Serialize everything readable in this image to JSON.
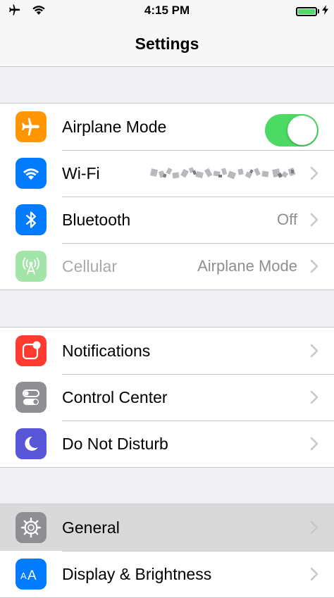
{
  "status_bar": {
    "time": "4:15 PM",
    "icons": [
      "airplane-icon",
      "wifi-icon",
      "battery-icon",
      "charging-bolt-icon"
    ]
  },
  "nav": {
    "title": "Settings"
  },
  "colors": {
    "orange": "#ff9500",
    "blue": "#007aff",
    "green_dim": "#a3e4a8",
    "red": "#ff3b30",
    "gray": "#8e8e93",
    "purple": "#5856d6",
    "toggle_on": "#4cd964"
  },
  "groups": [
    {
      "rows": [
        {
          "label": "Airplane Mode",
          "icon": "airplane-icon",
          "control": "toggle",
          "toggle_on": true
        },
        {
          "label": "Wi-Fi",
          "icon": "wifi-icon",
          "value": "",
          "value_obscured": true
        },
        {
          "label": "Bluetooth",
          "icon": "bluetooth-icon",
          "value": "Off"
        },
        {
          "label": "Cellular",
          "icon": "cellular-antenna-icon",
          "value": "Airplane Mode",
          "disabled": true
        }
      ]
    },
    {
      "rows": [
        {
          "label": "Notifications",
          "icon": "notifications-icon"
        },
        {
          "label": "Control Center",
          "icon": "control-center-icon"
        },
        {
          "label": "Do Not Disturb",
          "icon": "moon-icon"
        }
      ]
    },
    {
      "rows": [
        {
          "label": "General",
          "icon": "gear-icon",
          "highlighted": true
        },
        {
          "label": "Display & Brightness",
          "icon": "display-brightness-icon"
        }
      ]
    }
  ]
}
